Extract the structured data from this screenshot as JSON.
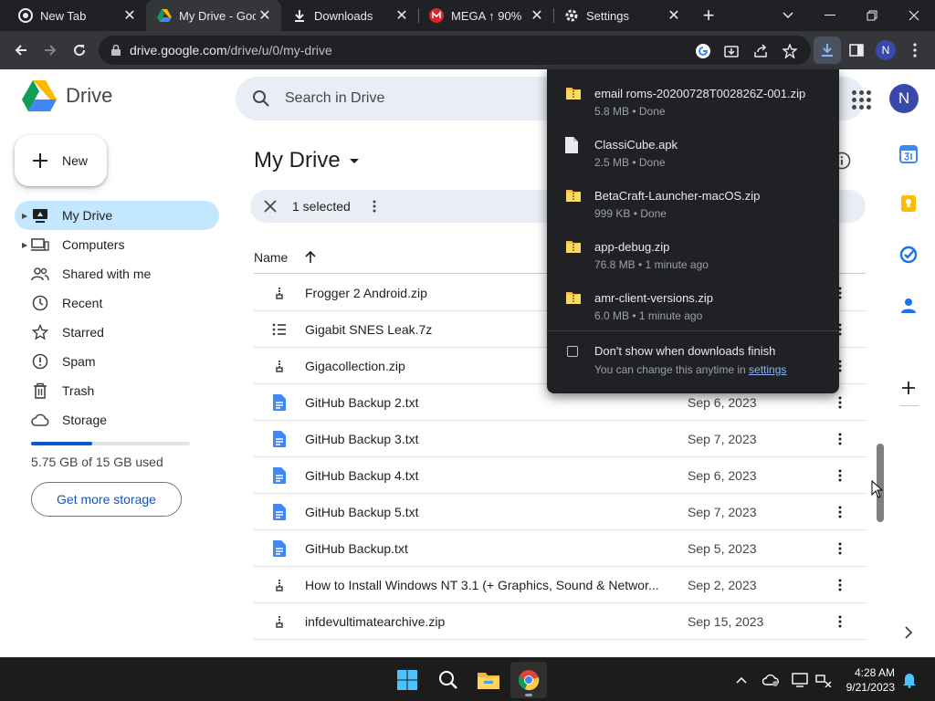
{
  "browser": {
    "tabs": [
      {
        "title": "New Tab",
        "icon": "chrome-icon"
      },
      {
        "title": "My Drive - Goog",
        "icon": "drive-icon",
        "active": true
      },
      {
        "title": "Downloads",
        "icon": "download-icon"
      },
      {
        "title": "MEGA ↑ 90%",
        "icon": "mega-icon"
      },
      {
        "title": "Settings",
        "icon": "gear-icon"
      }
    ],
    "url_host": "drive.google.com",
    "url_path": "/drive/u/0/my-drive",
    "profile_initial": "N"
  },
  "drive": {
    "logo_text": "Drive",
    "search_placeholder": "Search in Drive",
    "avatar_initial": "N",
    "new_label": "New",
    "nav": [
      {
        "label": "My Drive",
        "icon": "my-drive-icon",
        "active": true,
        "expandable": true
      },
      {
        "label": "Computers",
        "icon": "computers-icon",
        "expandable": true
      },
      {
        "label": "Shared with me",
        "icon": "shared-icon"
      },
      {
        "label": "Recent",
        "icon": "clock-icon"
      },
      {
        "label": "Starred",
        "icon": "star-icon"
      },
      {
        "label": "Spam",
        "icon": "spam-icon"
      },
      {
        "label": "Trash",
        "icon": "trash-icon"
      },
      {
        "label": "Storage",
        "icon": "cloud-icon"
      }
    ],
    "storage_used_fraction": 0.383,
    "storage_text": "5.75 GB of 15 GB used",
    "get_storage_label": "Get more storage",
    "title": "My Drive",
    "selected_text": "1 selected",
    "column_name": "Name",
    "files": [
      {
        "name": "Frogger 2 Android.zip",
        "date": "",
        "icon": "zip-icon"
      },
      {
        "name": "Gigabit SNES Leak.7z",
        "date": "",
        "icon": "list-file-icon"
      },
      {
        "name": "Gigacollection.zip",
        "date": "",
        "icon": "zip-icon"
      },
      {
        "name": "GitHub Backup 2.txt",
        "date": "Sep 6, 2023",
        "icon": "doc-icon"
      },
      {
        "name": "GitHub Backup 3.txt",
        "date": "Sep 7, 2023",
        "icon": "doc-icon"
      },
      {
        "name": "GitHub Backup 4.txt",
        "date": "Sep 6, 2023",
        "icon": "doc-icon"
      },
      {
        "name": "GitHub Backup 5.txt",
        "date": "Sep 7, 2023",
        "icon": "doc-icon"
      },
      {
        "name": "GitHub Backup.txt",
        "date": "Sep 5, 2023",
        "icon": "doc-icon"
      },
      {
        "name": "How to Install Windows NT 3.1 (+ Graphics, Sound & Networ...",
        "date": "Sep 2, 2023",
        "icon": "zip-icon"
      },
      {
        "name": "infdevultimatearchive.zip",
        "date": "Sep 15, 2023",
        "icon": "zip-icon"
      }
    ]
  },
  "downloads": {
    "items": [
      {
        "name": "email roms-20200728T002826Z-001.zip",
        "status": "5.8 MB • Done",
        "icon": "folder-zip-icon"
      },
      {
        "name": "ClassiCube.apk",
        "status": "2.5 MB • Done",
        "icon": "file-icon"
      },
      {
        "name": "BetaCraft-Launcher-macOS.zip",
        "status": "999 KB • Done",
        "icon": "folder-zip-icon"
      },
      {
        "name": "app-debug.zip",
        "status": "76.8 MB • 1 minute ago",
        "icon": "folder-zip-icon"
      },
      {
        "name": "amr-client-versions.zip",
        "status": "6.0 MB • 1 minute ago",
        "icon": "folder-zip-icon"
      }
    ],
    "option_label": "Don't show when downloads finish",
    "hint_text": "You can change this anytime in",
    "hint_link": "settings"
  },
  "taskbar": {
    "time": "4:28 AM",
    "date": "9/21/2023"
  }
}
